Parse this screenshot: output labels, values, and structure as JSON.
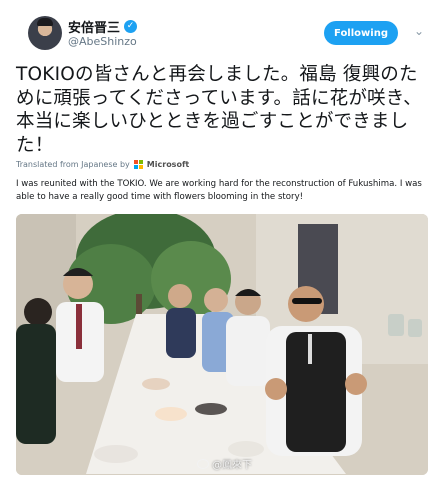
{
  "header": {
    "display_name": "安倍晋三",
    "handle": "@AbeShinzo",
    "follow_label": "Following",
    "verified_icon": "verified-badge-icon",
    "avatar_icon": "avatar"
  },
  "tweet": {
    "text": "TOKIOの皆さんと再会しました。福島 復興のために頑張ってくださっています。話に花が咲き、本当に楽しいひとときを過ごすことができました！",
    "translated_from": "Translated from Japanese by",
    "translator": "Microsoft",
    "translation": "I was reunited with the TOKIO. We are working hard for the reconstruction of Fukushima. I was able to have a really good time with flowers blooming in the story!"
  },
  "photo": {
    "watermark": "@鳳來下"
  },
  "colors": {
    "accent": "#1da1f2",
    "text": "#14171a",
    "muted": "#657786"
  }
}
